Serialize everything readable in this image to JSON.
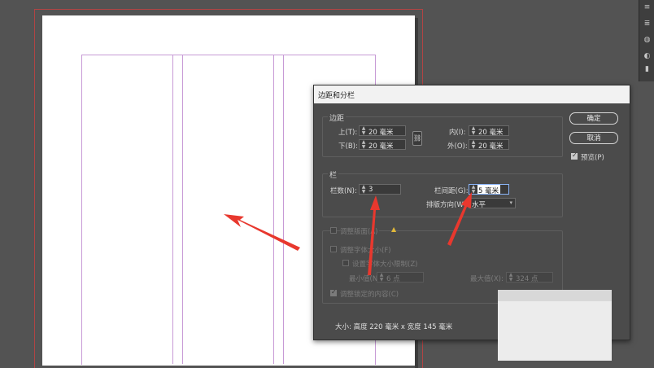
{
  "dialog": {
    "title": "边距和分栏",
    "ok_label": "确定",
    "cancel_label": "取消",
    "preview_label": "预览(P)",
    "preview_checked": true,
    "margins": {
      "group_label": "边距",
      "top_label": "上(T):",
      "top_value": "20 毫米",
      "bottom_label": "下(B):",
      "bottom_value": "20 毫米",
      "inside_label": "内(I):",
      "inside_value": "20 毫米",
      "outside_label": "外(O):",
      "outside_value": "20 毫米"
    },
    "columns": {
      "group_label": "栏",
      "count_label": "栏数(N):",
      "count_value": "3",
      "gutter_label": "栏间距(G):",
      "gutter_value": "5 毫米",
      "direction_label": "排版方向(W):",
      "direction_value": "水平"
    },
    "adjust": {
      "layout_label": "调整版面(A)",
      "font_size_label": "调整字体大小(F)",
      "font_limit_label": "设置字体大小限制(Z)",
      "min_label": "最小值(N):",
      "min_value": "6 点",
      "max_label": "最大值(X):",
      "max_value": "324 点",
      "locked_label": "调整锁定的内容(C)"
    },
    "status": "大小: 高度 220 毫米 x 宽度 145 毫米"
  },
  "colors": {
    "workspace": "#535353",
    "dialog_bg": "#4b4b4b",
    "margin_guide": "#c79ad6",
    "bleed_guide": "#b14444",
    "annotation_arrow": "#e8382e"
  }
}
